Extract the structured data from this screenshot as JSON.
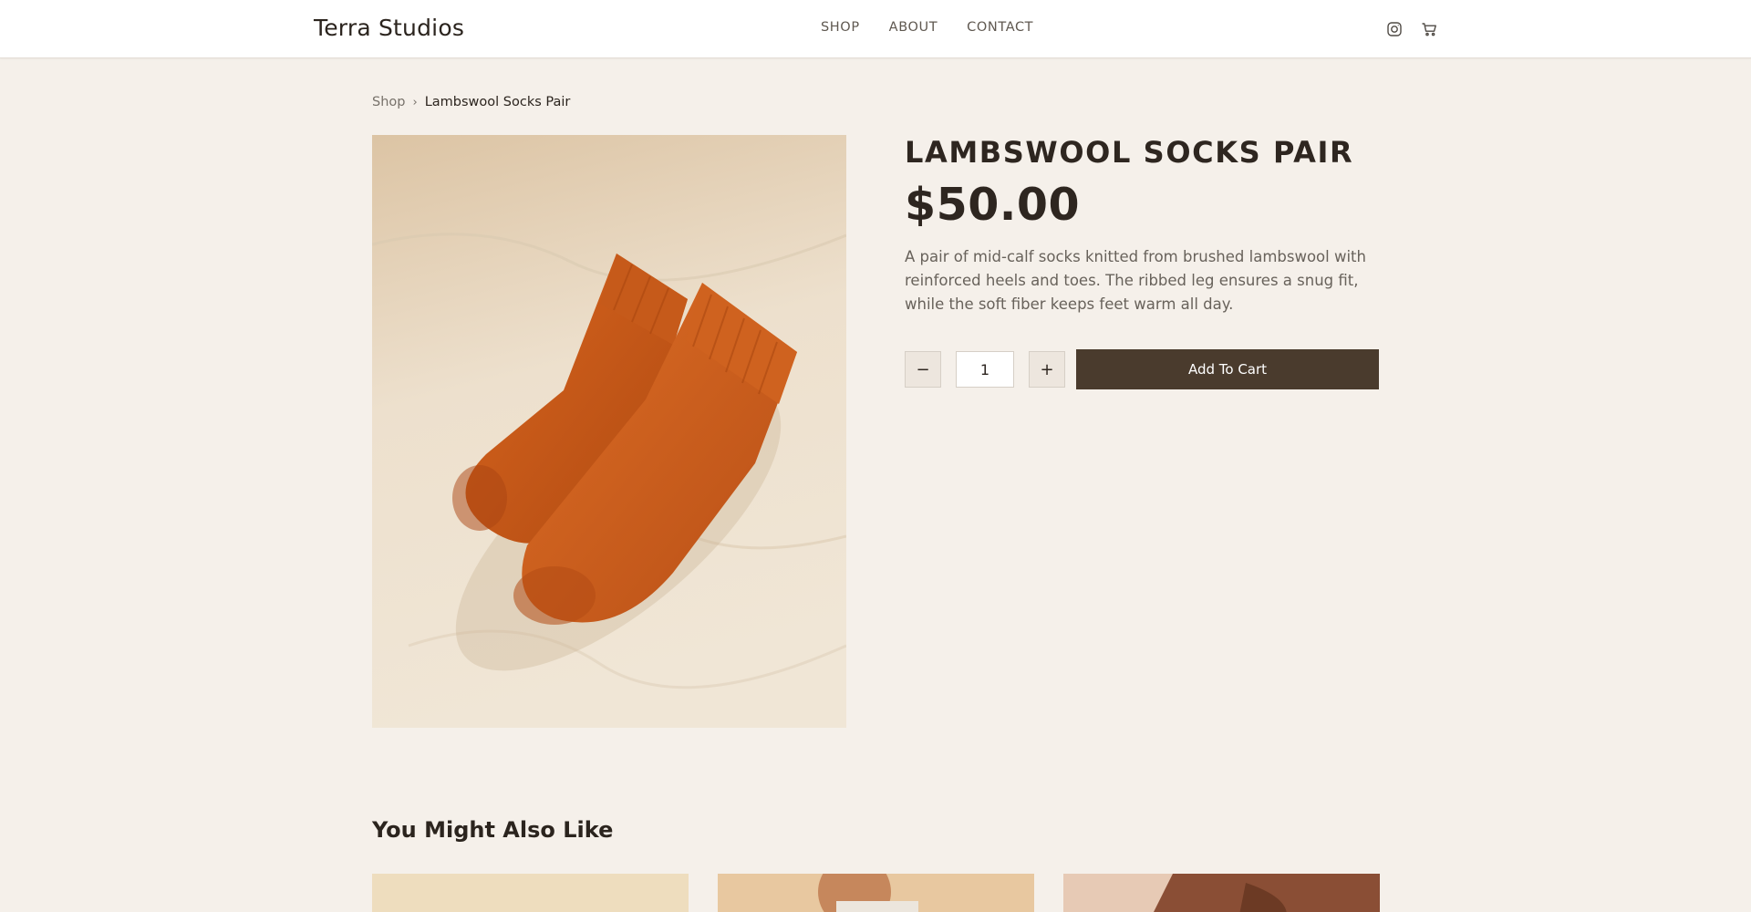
{
  "header": {
    "brand": "Terra Studios",
    "nav": [
      "SHOP",
      "ABOUT",
      "CONTACT"
    ],
    "icons": [
      "instagram-icon",
      "cart-icon"
    ]
  },
  "breadcrumb": {
    "root": "Shop",
    "separator": "›",
    "current": "Lambswool Socks Pair"
  },
  "product": {
    "title": "LAMBSWOOL SOCKS PAIR",
    "price": "$50.00",
    "description": "A pair of mid-calf socks knitted from brushed lambswool with reinforced heels and toes. The ribbed leg ensures a snug fit, while the soft fiber keeps feet warm all day.",
    "quantity": "1",
    "decrement": "−",
    "increment": "+",
    "add_to_cart": "Add To Cart",
    "image_colors": {
      "background": "#e9dcc8",
      "sock": "#c45a1c"
    }
  },
  "related": {
    "heading": "You Might Also Like"
  },
  "colors": {
    "page_bg": "#f5f0ea",
    "accent_button": "#4a3b2d"
  }
}
